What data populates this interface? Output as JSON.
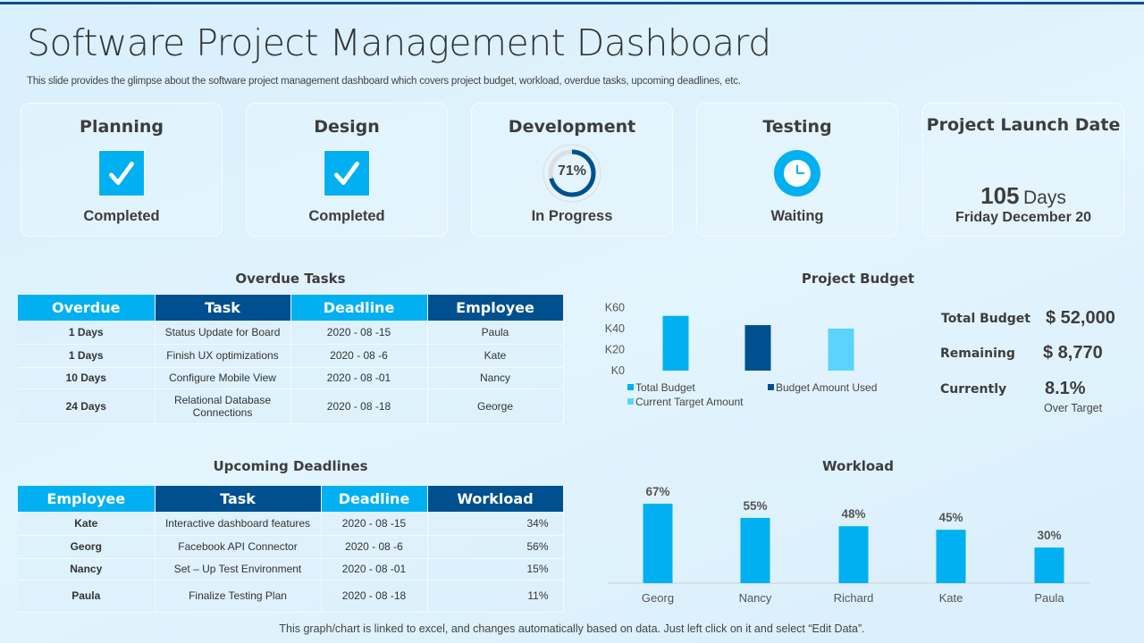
{
  "header": {
    "title": "Software Project Management Dashboard",
    "subtitle": "This slide provides the glimpse about the software project management dashboard which covers project budget, workload, overdue tasks, upcoming deadlines, etc."
  },
  "stages": [
    {
      "title": "Planning",
      "status": "Completed",
      "icon": "checkmark-icon"
    },
    {
      "title": "Design",
      "status": "Completed",
      "icon": "checkmark-icon"
    },
    {
      "title": "Development",
      "status": "In Progress",
      "icon": "progress-donut",
      "progress_percent": 71,
      "progress_label": "71%"
    },
    {
      "title": "Testing",
      "status": "Waiting",
      "icon": "clock-icon"
    }
  ],
  "launch": {
    "title": "Project  Launch Date",
    "days_number": "105",
    "days_unit": "Days",
    "date": "Friday December 20"
  },
  "overdue_tasks": {
    "title": "Overdue Tasks",
    "columns": [
      "Overdue",
      "Task",
      "Deadline",
      "Employee"
    ],
    "rows": [
      [
        "1 Days",
        "Status Update for Board",
        "2020 - 08 -15",
        "Paula"
      ],
      [
        "1 Days",
        "Finish UX optimizations",
        "2020 - 08 -6",
        "Kate"
      ],
      [
        "10 Days",
        "Configure Mobile View",
        "2020 - 08 -01",
        "Nancy"
      ],
      [
        "24 Days",
        "Relational Database Connections",
        "2020 - 08 -18",
        "George"
      ]
    ]
  },
  "upcoming_deadlines": {
    "title": "Upcoming Deadlines",
    "columns": [
      "Employee",
      "Task",
      "Deadline",
      "Workload"
    ],
    "rows": [
      [
        "Kate",
        "Interactive dashboard features",
        "2020 - 08 -15",
        "34%"
      ],
      [
        "Georg",
        "Facebook API  Connector",
        "2020 - 08 -6",
        "56%"
      ],
      [
        "Nancy",
        "Set – Up Test Environment",
        "2020 - 08 -01",
        "15%"
      ],
      [
        "Paula",
        "Finalize Testing Plan",
        "2020 - 08 -18",
        "11%"
      ]
    ]
  },
  "budget_summary": {
    "total_label": "Total Budget",
    "total_value": "$ 52,000",
    "remaining_label": "Remaining",
    "remaining_value": "$ 8,770",
    "currently_label": "Currently",
    "currently_value": "8.1%",
    "currently_note": "Over Target"
  },
  "colors": {
    "accent_light": "#00b0f0",
    "accent_dark": "#00508f",
    "accent_pale": "#5bd3fd",
    "text": "#3d3d3d"
  },
  "chart_data": [
    {
      "type": "bar",
      "title": "Project Budget",
      "categories": [
        "Total Budget",
        "Budget Amount Used",
        "Current Target Amount"
      ],
      "values": [
        52000,
        43230,
        40000
      ],
      "colors": [
        "#00b0f0",
        "#00508f",
        "#5bd3fd"
      ],
      "yticks": [
        0,
        20000,
        40000,
        60000
      ],
      "ytick_labels": [
        "K0",
        "K20",
        "K40",
        "K60"
      ],
      "ylim": [
        0,
        60000
      ],
      "xlabel": "",
      "ylabel": "",
      "grid": false,
      "legend": [
        "Total Budget",
        "Budget Amount Used",
        "Current Target Amount"
      ],
      "legend_position": "bottom"
    },
    {
      "type": "bar",
      "title": "Workload",
      "categories": [
        "Georg",
        "Nancy",
        "Richard",
        "Kate",
        "Paula"
      ],
      "values": [
        67,
        55,
        48,
        45,
        30
      ],
      "data_labels": [
        "67%",
        "55%",
        "48%",
        "45%",
        "30%"
      ],
      "color": "#00b0f0",
      "ylim": [
        0,
        70
      ],
      "xlabel": "",
      "ylabel": "",
      "grid": false
    }
  ],
  "footer": {
    "note": "This graph/chart is linked to excel, and changes automatically based on data. Just left click on it and select “Edit Data”."
  }
}
